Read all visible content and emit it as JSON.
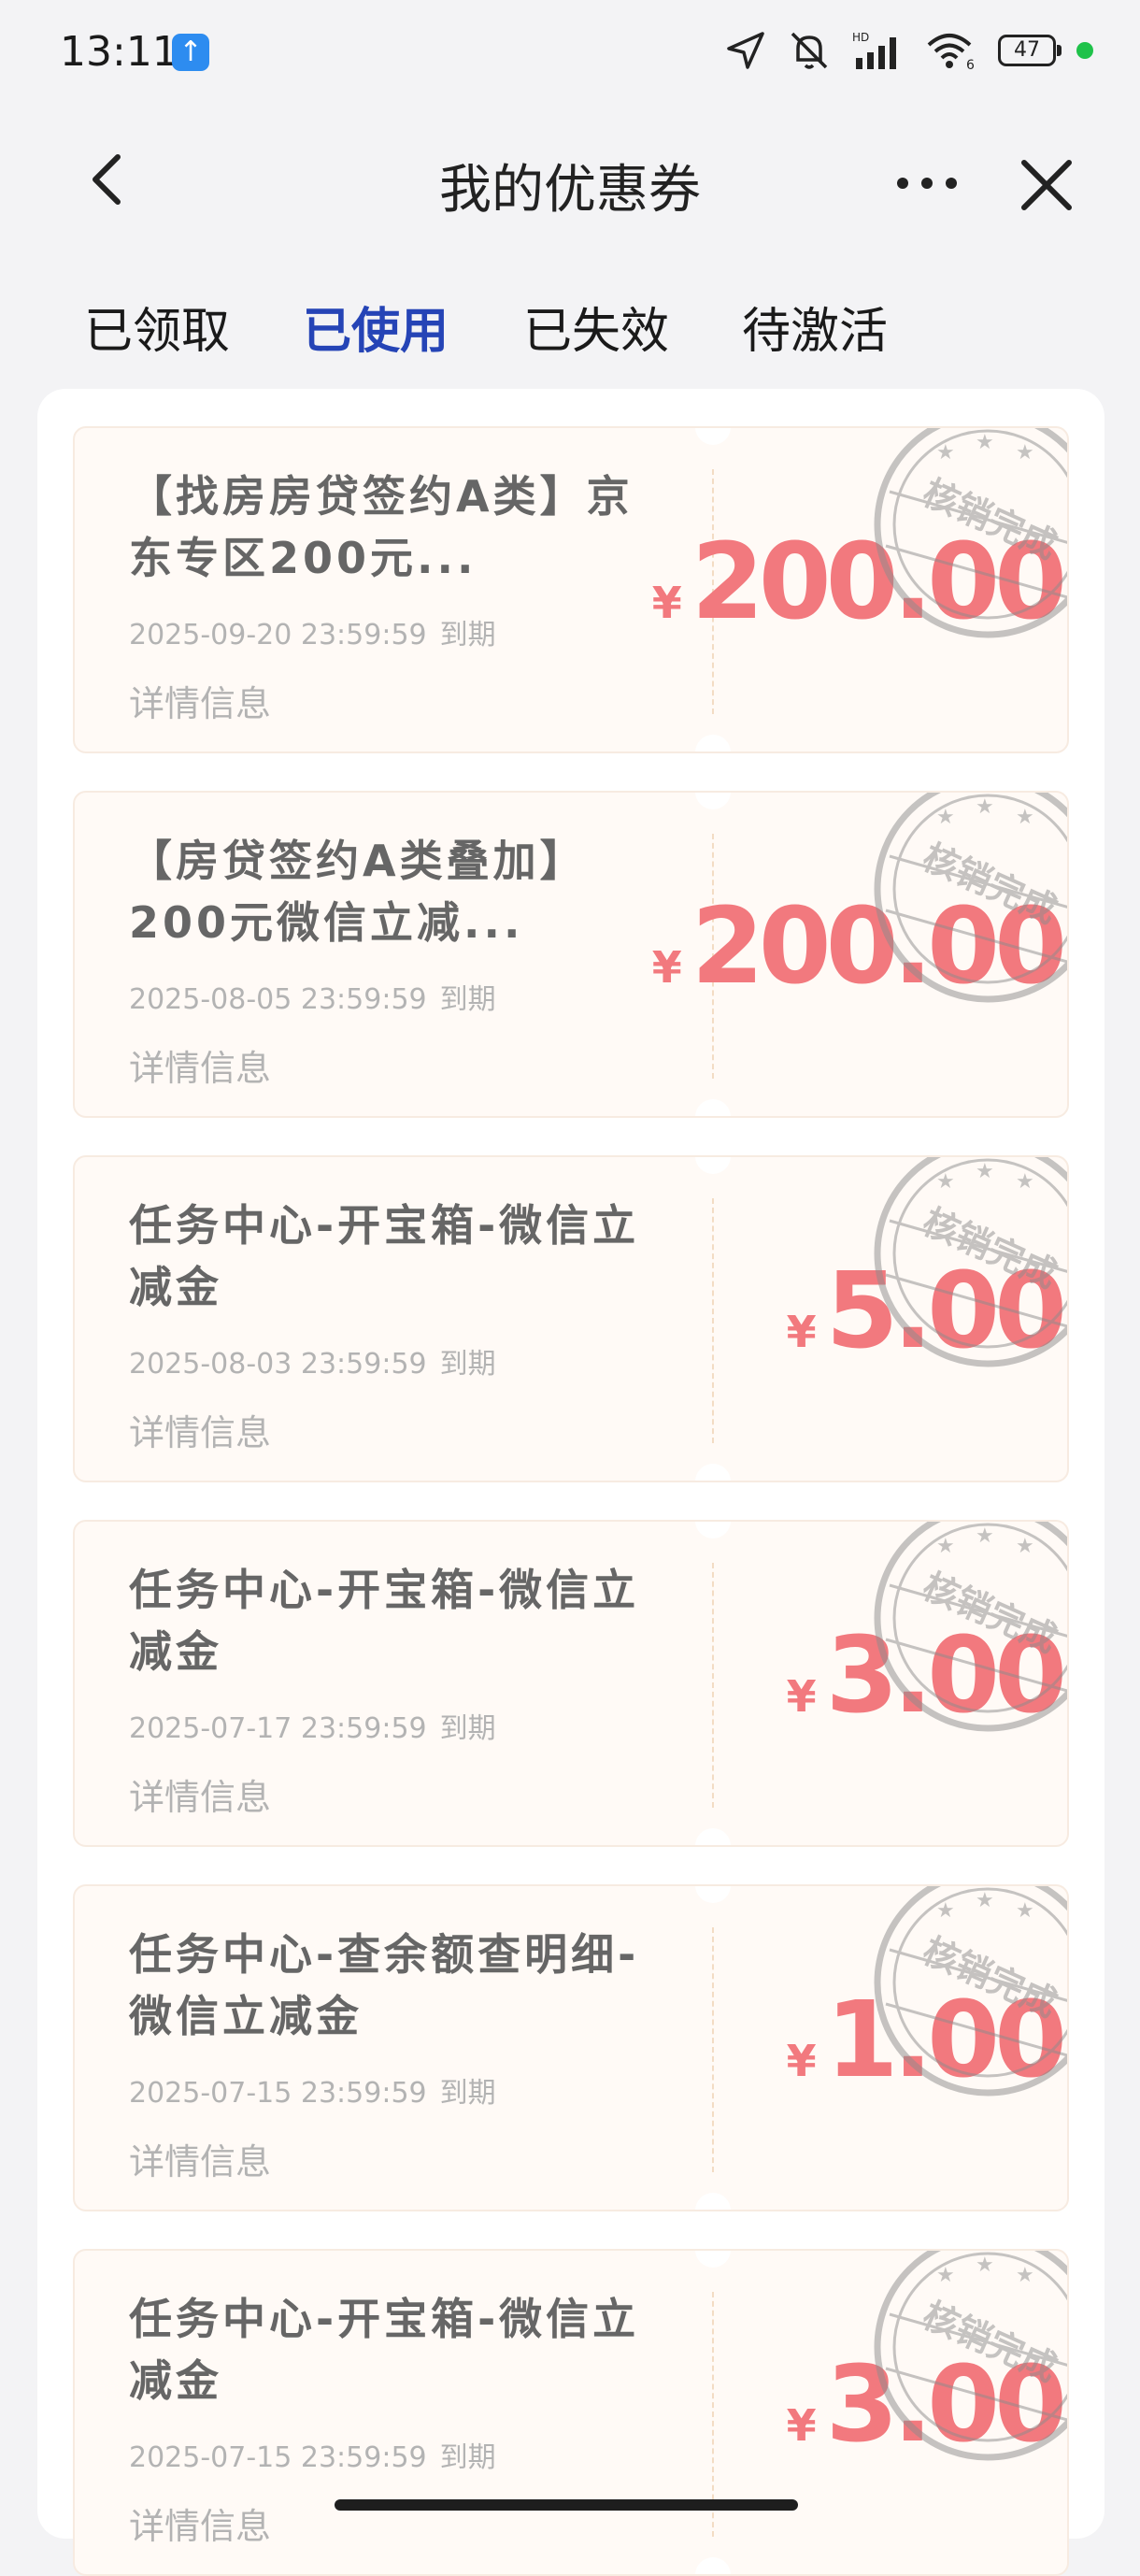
{
  "status_bar": {
    "time": "13:11",
    "battery": "47"
  },
  "nav": {
    "title": "我的优惠券"
  },
  "tabs": [
    {
      "label": "已领取",
      "active": false
    },
    {
      "label": "已使用",
      "active": true
    },
    {
      "label": "已失效",
      "active": false
    },
    {
      "label": "待激活",
      "active": false
    }
  ],
  "stamp_text": "核销完成",
  "currency_symbol": "¥",
  "coupons": [
    {
      "title": "【找房房贷签约A类】京东专区200元...",
      "expiry": "2025-09-20 23:59:59",
      "expiry_suffix": "到期",
      "details": "详情信息",
      "amount": "200.00"
    },
    {
      "title": "【房贷签约A类叠加】200元微信立减...",
      "expiry": "2025-08-05 23:59:59",
      "expiry_suffix": "到期",
      "details": "详情信息",
      "amount": "200.00"
    },
    {
      "title": "任务中心-开宝箱-微信立减金",
      "expiry": "2025-08-03 23:59:59",
      "expiry_suffix": "到期",
      "details": "详情信息",
      "amount": "5.00"
    },
    {
      "title": "任务中心-开宝箱-微信立减金",
      "expiry": "2025-07-17 23:59:59",
      "expiry_suffix": "到期",
      "details": "详情信息",
      "amount": "3.00"
    },
    {
      "title": "任务中心-查余额查明细-微信立减金",
      "expiry": "2025-07-15 23:59:59",
      "expiry_suffix": "到期",
      "details": "详情信息",
      "amount": "1.00"
    },
    {
      "title": "任务中心-开宝箱-微信立减金",
      "expiry": "2025-07-15 23:59:59",
      "expiry_suffix": "到期",
      "details": "详情信息",
      "amount": "3.00"
    }
  ]
}
